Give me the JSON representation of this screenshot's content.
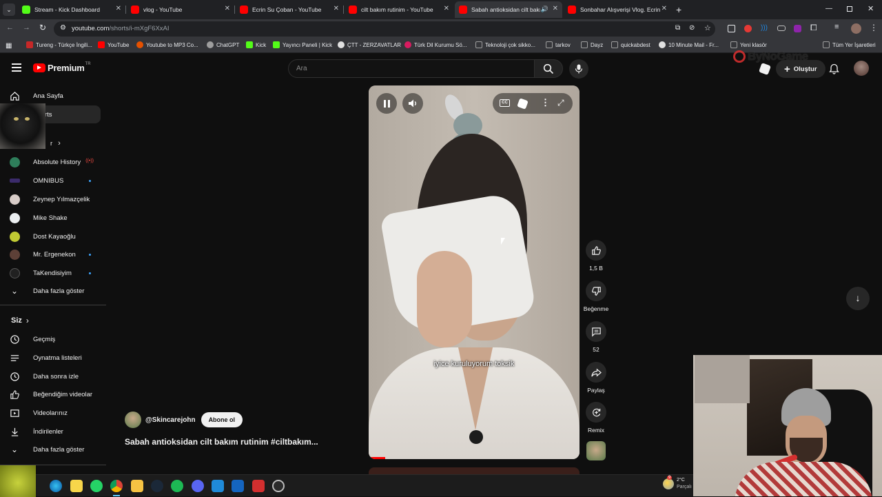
{
  "browser": {
    "tabs": [
      {
        "title": "Stream - Kick Dashboard",
        "favicon_color": "#53fc18"
      },
      {
        "title": "vlog - YouTube",
        "favicon_color": "#ff0000"
      },
      {
        "title": "Ecrin Su Çoban - YouTube",
        "favicon_color": "#ff0000"
      },
      {
        "title": "cilt bakım rutinim - YouTube",
        "favicon_color": "#ff0000"
      },
      {
        "title": "Sabah antioksidan cilt bakım",
        "favicon_color": "#ff0000"
      },
      {
        "title": "Sonbahar Alışverişi Vlog. Ecrin",
        "favicon_color": "#ff0000"
      }
    ],
    "url_host": "youtube.com",
    "url_path": "/shorts/i-mXgF6XxAI",
    "bookmarks": [
      {
        "label": "Tureng - Türkçe İngili...",
        "color": "#c62828"
      },
      {
        "label": "YouTube",
        "color": "#ff0000"
      },
      {
        "label": "Youtube to MP3 Co...",
        "color": "#e65100"
      },
      {
        "label": "ChatGPT",
        "color": "#9e9e9e"
      },
      {
        "label": "Kick",
        "color": "#53fc18"
      },
      {
        "label": "Yayıncı Paneli | Kick",
        "color": "#53fc18"
      },
      {
        "label": "ÇTT - ZERZAVATLAR",
        "color": "#e0e0e0"
      },
      {
        "label": "Türk Dil Kurumu Sö...",
        "color": "#d81b60"
      },
      {
        "label": "Teknoloji çok sikko...",
        "color": "#9e9e9e"
      },
      {
        "label": "tarkov",
        "color": "#9e9e9e"
      },
      {
        "label": "Dayz",
        "color": "#9e9e9e"
      },
      {
        "label": "quickabdest",
        "color": "#9e9e9e"
      },
      {
        "label": "10 Minute Mail - Fr...",
        "color": "#e0e0e0"
      },
      {
        "label": "Yeni klasör",
        "color": "#9e9e9e"
      },
      {
        "label": "Tüm Yer İşaretleri",
        "color": "#9e9e9e"
      }
    ]
  },
  "header": {
    "logo_text": "Premium",
    "logo_sup": "TR",
    "search_placeholder": "Ara",
    "create_label": "Oluştur",
    "watermark": "ByNoGame"
  },
  "sidebar": {
    "home": "Ana Sayfa",
    "shorts": "Shorts",
    "subs_partial": "r",
    "channels": [
      {
        "name": "Absolute History",
        "color": "#2e7d5a",
        "live": true
      },
      {
        "name": "OMNIBUS",
        "color": "#3b2b6b",
        "dot": true
      },
      {
        "name": "Zeynep Yılmazçelik",
        "color": "#d7ccc8",
        "dot": false
      },
      {
        "name": "Mike Shake",
        "color": "#eceff1",
        "dot": false
      },
      {
        "name": "Dost Kayaoğlu",
        "color": "#c0ca33",
        "dot": false
      },
      {
        "name": "Mr. Ergenekon",
        "color": "#5d4037",
        "dot": true
      },
      {
        "name": "TaKendisiyim",
        "color": "#212121",
        "dot": true
      }
    ],
    "show_more": "Daha fazla göster",
    "you": "Siz",
    "you_items": [
      "Geçmiş",
      "Oynatma listeleri",
      "Daha sonra izle",
      "Beğendiğim videolar",
      "Videolarınız",
      "İndirilenler",
      "Daha fazla göster"
    ]
  },
  "short": {
    "channel": "@Skincarejohn",
    "subscribe": "Abone ol",
    "title": "Sabah antioksidan cilt bakım rutinim #ciltbakım...",
    "caption": "iyice kuruluyorum toksik",
    "likes": "1,5 B",
    "dislike_label": "Beğenme",
    "comments": "52",
    "share_label": "Paylaş",
    "remix_label": "Remix"
  },
  "tray": {
    "temp": "2°C",
    "weather_label": "Parçalı",
    "notification_count": "9"
  }
}
